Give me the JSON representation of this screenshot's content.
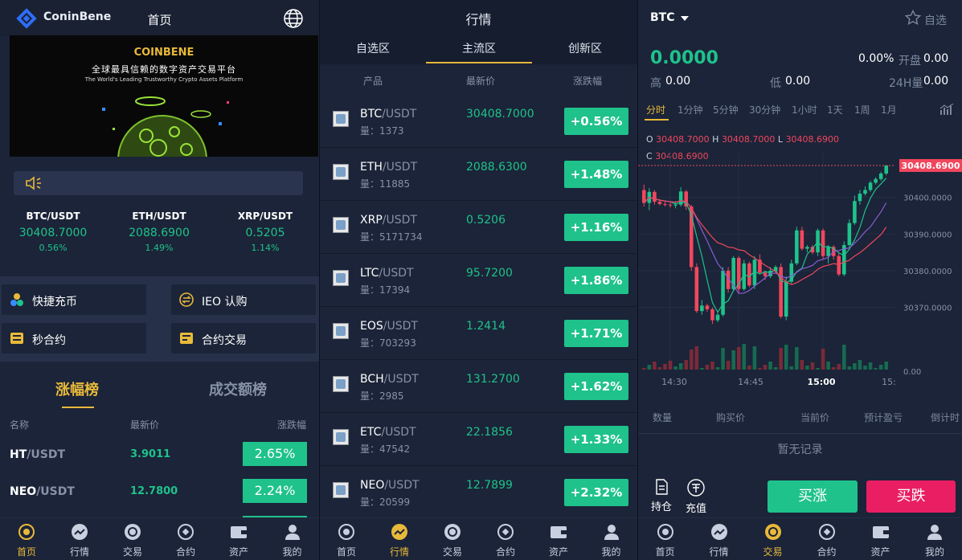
{
  "panel1": {
    "logo_text": "ConinBene",
    "title": "首页",
    "banner": {
      "brand": "COINBENE",
      "slogan_cn": "全球最具信赖的数字资产交易平台",
      "slogan_en": "The World's Leading Trustworthy Crypto Assets Platform"
    },
    "tickers": [
      {
        "pair": "BTC/USDT",
        "price": "30408.7000",
        "change": "0.56%"
      },
      {
        "pair": "ETH/USDT",
        "price": "2088.6900",
        "change": "1.49%"
      },
      {
        "pair": "XRP/USDT",
        "price": "0.5205",
        "change": "1.14%"
      }
    ],
    "quick": [
      {
        "label": "快捷充币",
        "icon": "coins-icon"
      },
      {
        "label": "IEO 认购",
        "icon": "exchange-icon"
      },
      {
        "label": "秒合约",
        "icon": "contract-icon"
      },
      {
        "label": "合约交易",
        "icon": "contract-trade-icon"
      }
    ],
    "rank_tabs": [
      "涨幅榜",
      "成交额榜"
    ],
    "rank_headers": [
      "名称",
      "最新价",
      "涨跌幅"
    ],
    "rank_rows": [
      {
        "base": "HT",
        "quote": "/USDT",
        "price": "3.9011",
        "change": "2.65%"
      },
      {
        "base": "NEO",
        "quote": "/USDT",
        "price": "12.7800",
        "change": "2.24%"
      }
    ]
  },
  "tabbar": [
    {
      "label": "首页",
      "icon": "home-icon"
    },
    {
      "label": "行情",
      "icon": "market-icon"
    },
    {
      "label": "交易",
      "icon": "trade-icon"
    },
    {
      "label": "合约",
      "icon": "contract-icon"
    },
    {
      "label": "资产",
      "icon": "wallet-icon"
    },
    {
      "label": "我的",
      "icon": "user-icon"
    }
  ],
  "panel2": {
    "title": "行情",
    "tabs": [
      "自选区",
      "主流区",
      "创新区"
    ],
    "headers": [
      "产品",
      "最新价",
      "涨跌幅"
    ],
    "vol_label": "量：",
    "rows": [
      {
        "base": "BTC",
        "quote": "/USDT",
        "vol": "1373",
        "price": "30408.7000",
        "change": "+0.56%"
      },
      {
        "base": "ETH",
        "quote": "/USDT",
        "vol": "11885",
        "price": "2088.6300",
        "change": "+1.48%"
      },
      {
        "base": "XRP",
        "quote": "/USDT",
        "vol": "5171734",
        "price": "0.5206",
        "change": "+1.16%"
      },
      {
        "base": "LTC",
        "quote": "/USDT",
        "vol": "17394",
        "price": "95.7200",
        "change": "+1.86%"
      },
      {
        "base": "EOS",
        "quote": "/USDT",
        "vol": "703293",
        "price": "1.2414",
        "change": "+1.71%"
      },
      {
        "base": "BCH",
        "quote": "/USDT",
        "vol": "2985",
        "price": "131.2700",
        "change": "+1.62%"
      },
      {
        "base": "ETC",
        "quote": "/USDT",
        "vol": "47542",
        "price": "22.1856",
        "change": "+1.33%"
      },
      {
        "base": "NEO",
        "quote": "/USDT",
        "vol": "20599",
        "price": "12.7899",
        "change": "+2.32%"
      }
    ]
  },
  "panel3": {
    "symbol": "BTC",
    "fav_label": "自选",
    "last_price": "0.0000",
    "change": "0.00%",
    "open_label": "开盘",
    "open": "0.00",
    "high_label": "高",
    "high": "0.00",
    "low_label": "低",
    "low": "0.00",
    "vol_label": "24H量",
    "vol": "0.00",
    "intervals": [
      "分时",
      "1分钟",
      "5分钟",
      "30分钟",
      "1小时",
      "1天",
      "1周",
      "1月"
    ],
    "ohlc": {
      "o_label": "O",
      "o": "30408.7000",
      "h_label": "H",
      "h": "30408.7000",
      "l_label": "L",
      "l": "30408.6900",
      "c_label": "C",
      "c": "30408.6900"
    },
    "current_price_tag": "30408.6900",
    "table_headers": [
      "数量",
      "购买价",
      "当前价",
      "预计盈亏",
      "倒计时"
    ],
    "empty": "暂无记录",
    "hold_label": "持仓",
    "deposit_label": "充值",
    "buy_up": "买涨",
    "buy_down": "买跌"
  },
  "colors": {
    "up": "#1fc28b",
    "down": "#f0475e",
    "accent": "#e8b93a",
    "sell": "#e91e63",
    "bg": "#1b2438"
  },
  "chart_data": {
    "type": "candlestick",
    "y_ticks": [
      "30400.0000",
      "30390.0000",
      "30380.0000",
      "30370.0000",
      "0.00"
    ],
    "x_ticks": [
      "14:30",
      "14:45",
      "15:00",
      "15:"
    ],
    "ylim": [
      30364,
      30410
    ],
    "candles": [
      {
        "o": 30402.0,
        "c": 30398.5,
        "h": 30403.5,
        "l": 30397.5
      },
      {
        "o": 30398.5,
        "c": 30401.5,
        "h": 30402.5,
        "l": 30396.5
      },
      {
        "o": 30401.5,
        "c": 30398.8,
        "h": 30402.0,
        "l": 30398.0
      },
      {
        "o": 30398.8,
        "c": 30398.2,
        "h": 30399.5,
        "l": 30397.8
      },
      {
        "o": 30398.2,
        "c": 30398.0,
        "h": 30399.0,
        "l": 30397.5
      },
      {
        "o": 30398.0,
        "c": 30397.8,
        "h": 30398.6,
        "l": 30397.2
      },
      {
        "o": 30397.8,
        "c": 30398.0,
        "h": 30399.0,
        "l": 30397.0
      },
      {
        "o": 30398.0,
        "c": 30401.6,
        "h": 30402.8,
        "l": 30397.5
      },
      {
        "o": 30401.6,
        "c": 30397.5,
        "h": 30402.0,
        "l": 30396.6
      },
      {
        "o": 30397.5,
        "c": 30381.0,
        "h": 30398.0,
        "l": 30380.0
      },
      {
        "o": 30381.0,
        "c": 30369.0,
        "h": 30382.0,
        "l": 30368.5
      },
      {
        "o": 30369.0,
        "c": 30370.5,
        "h": 30372.0,
        "l": 30368.0
      },
      {
        "o": 30370.5,
        "c": 30369.5,
        "h": 30371.0,
        "l": 30368.8
      },
      {
        "o": 30369.5,
        "c": 30366.5,
        "h": 30370.0,
        "l": 30365.5
      },
      {
        "o": 30366.5,
        "c": 30368.0,
        "h": 30369.0,
        "l": 30366.0
      },
      {
        "o": 30368.0,
        "c": 30380.0,
        "h": 30381.0,
        "l": 30367.5
      },
      {
        "o": 30380.0,
        "c": 30375.0,
        "h": 30381.0,
        "l": 30374.0
      },
      {
        "o": 30375.0,
        "c": 30383.5,
        "h": 30384.0,
        "l": 30374.5
      },
      {
        "o": 30383.5,
        "c": 30375.0,
        "h": 30384.0,
        "l": 30374.0
      },
      {
        "o": 30375.0,
        "c": 30382.0,
        "h": 30383.0,
        "l": 30374.5
      },
      {
        "o": 30382.0,
        "c": 30376.0,
        "h": 30382.5,
        "l": 30375.5
      },
      {
        "o": 30376.0,
        "c": 30383.0,
        "h": 30384.0,
        "l": 30375.0
      },
      {
        "o": 30383.0,
        "c": 30379.5,
        "h": 30384.5,
        "l": 30379.0
      },
      {
        "o": 30379.5,
        "c": 30378.5,
        "h": 30380.0,
        "l": 30377.5
      },
      {
        "o": 30378.5,
        "c": 30380.0,
        "h": 30381.0,
        "l": 30378.0
      },
      {
        "o": 30380.0,
        "c": 30381.0,
        "h": 30381.5,
        "l": 30379.5
      },
      {
        "o": 30381.0,
        "c": 30367.5,
        "h": 30382.0,
        "l": 30367.0
      },
      {
        "o": 30367.5,
        "c": 30377.0,
        "h": 30378.5,
        "l": 30366.5
      },
      {
        "o": 30377.0,
        "c": 30382.0,
        "h": 30383.0,
        "l": 30376.5
      },
      {
        "o": 30382.0,
        "c": 30391.0,
        "h": 30392.0,
        "l": 30381.5
      },
      {
        "o": 30391.0,
        "c": 30386.0,
        "h": 30392.0,
        "l": 30385.5
      },
      {
        "o": 30386.0,
        "c": 30386.5,
        "h": 30387.0,
        "l": 30385.0
      },
      {
        "o": 30386.5,
        "c": 30385.0,
        "h": 30387.0,
        "l": 30384.5
      },
      {
        "o": 30385.0,
        "c": 30391.0,
        "h": 30391.5,
        "l": 30384.0
      },
      {
        "o": 30391.0,
        "c": 30384.0,
        "h": 30391.5,
        "l": 30383.0
      },
      {
        "o": 30384.0,
        "c": 30386.5,
        "h": 30387.0,
        "l": 30382.0
      },
      {
        "o": 30386.5,
        "c": 30384.0,
        "h": 30387.0,
        "l": 30383.0
      },
      {
        "o": 30384.0,
        "c": 30379.0,
        "h": 30385.0,
        "l": 30378.5
      },
      {
        "o": 30379.0,
        "c": 30387.0,
        "h": 30388.0,
        "l": 30378.5
      },
      {
        "o": 30387.0,
        "c": 30393.0,
        "h": 30394.0,
        "l": 30386.0
      },
      {
        "o": 30393.0,
        "c": 30399.0,
        "h": 30400.5,
        "l": 30392.5
      },
      {
        "o": 30399.0,
        "c": 30401.0,
        "h": 30402.0,
        "l": 30398.0
      },
      {
        "o": 30401.0,
        "c": 30402.0,
        "h": 30403.0,
        "l": 30400.5
      },
      {
        "o": 30402.0,
        "c": 30404.0,
        "h": 30404.5,
        "l": 30401.5
      },
      {
        "o": 30404.0,
        "c": 30405.0,
        "h": 30405.5,
        "l": 30403.5
      },
      {
        "o": 30405.0,
        "c": 30406.5,
        "h": 30407.0,
        "l": 30404.5
      },
      {
        "o": 30406.5,
        "c": 30408.69,
        "h": 30408.7,
        "l": 30406.0
      }
    ]
  }
}
